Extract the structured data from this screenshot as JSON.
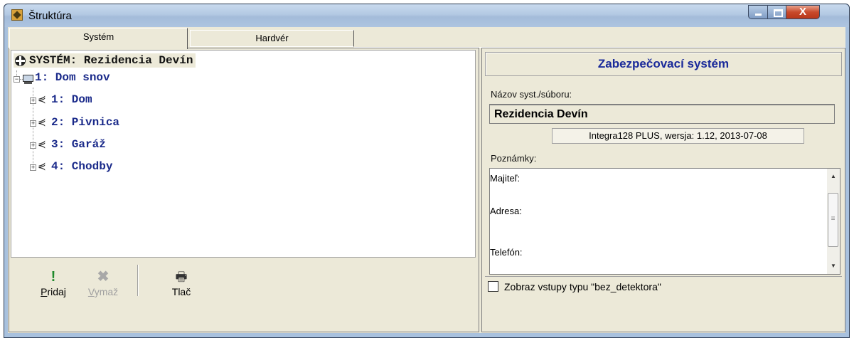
{
  "window": {
    "title": "Štruktúra",
    "controls": {
      "close_glyph": "X"
    }
  },
  "tabs": [
    {
      "label": "Systém",
      "selected": true
    },
    {
      "label": "Hardvér",
      "selected": false
    }
  ],
  "tree": {
    "root": "SYSTÉM: Rezidencia Devín",
    "module": "1: Dom snov",
    "partitions": [
      {
        "label": "1: Dom"
      },
      {
        "label": "2: Pivnica"
      },
      {
        "label": "3: Garáž"
      },
      {
        "label": "4: Chodby"
      }
    ]
  },
  "buttons": {
    "pridaj": {
      "label": "Pridaj",
      "accel": "P",
      "rest": "ridaj",
      "enabled": true,
      "icon": "exclamation-icon"
    },
    "vymaz": {
      "label": "Vymaž",
      "accel": "V",
      "rest": "ymaž",
      "enabled": false,
      "icon": "x-icon"
    },
    "tlac": {
      "label": "Tlač",
      "enabled": true,
      "icon": "printer-icon"
    }
  },
  "details": {
    "header": "Zabezpečovací systém",
    "name_label": "Názov syst./súboru:",
    "name_value": "Rezidencia Devín",
    "version": "Integra128 PLUS, wersja: 1.12,   2013-07-08",
    "notes_label": "Poznámky:",
    "notes_lines": [
      "Majiteľ:",
      "Adresa:",
      "Telefón:"
    ],
    "checkbox_label": "Zobraz vstupy typu \"bez_detektora\"",
    "checkbox_checked": false
  },
  "colors": {
    "tree_text": "#1a2a8a",
    "header_text": "#1a2a9a",
    "pridaj_icon": "#1f8a2c",
    "close_button": "#c84a2c"
  }
}
